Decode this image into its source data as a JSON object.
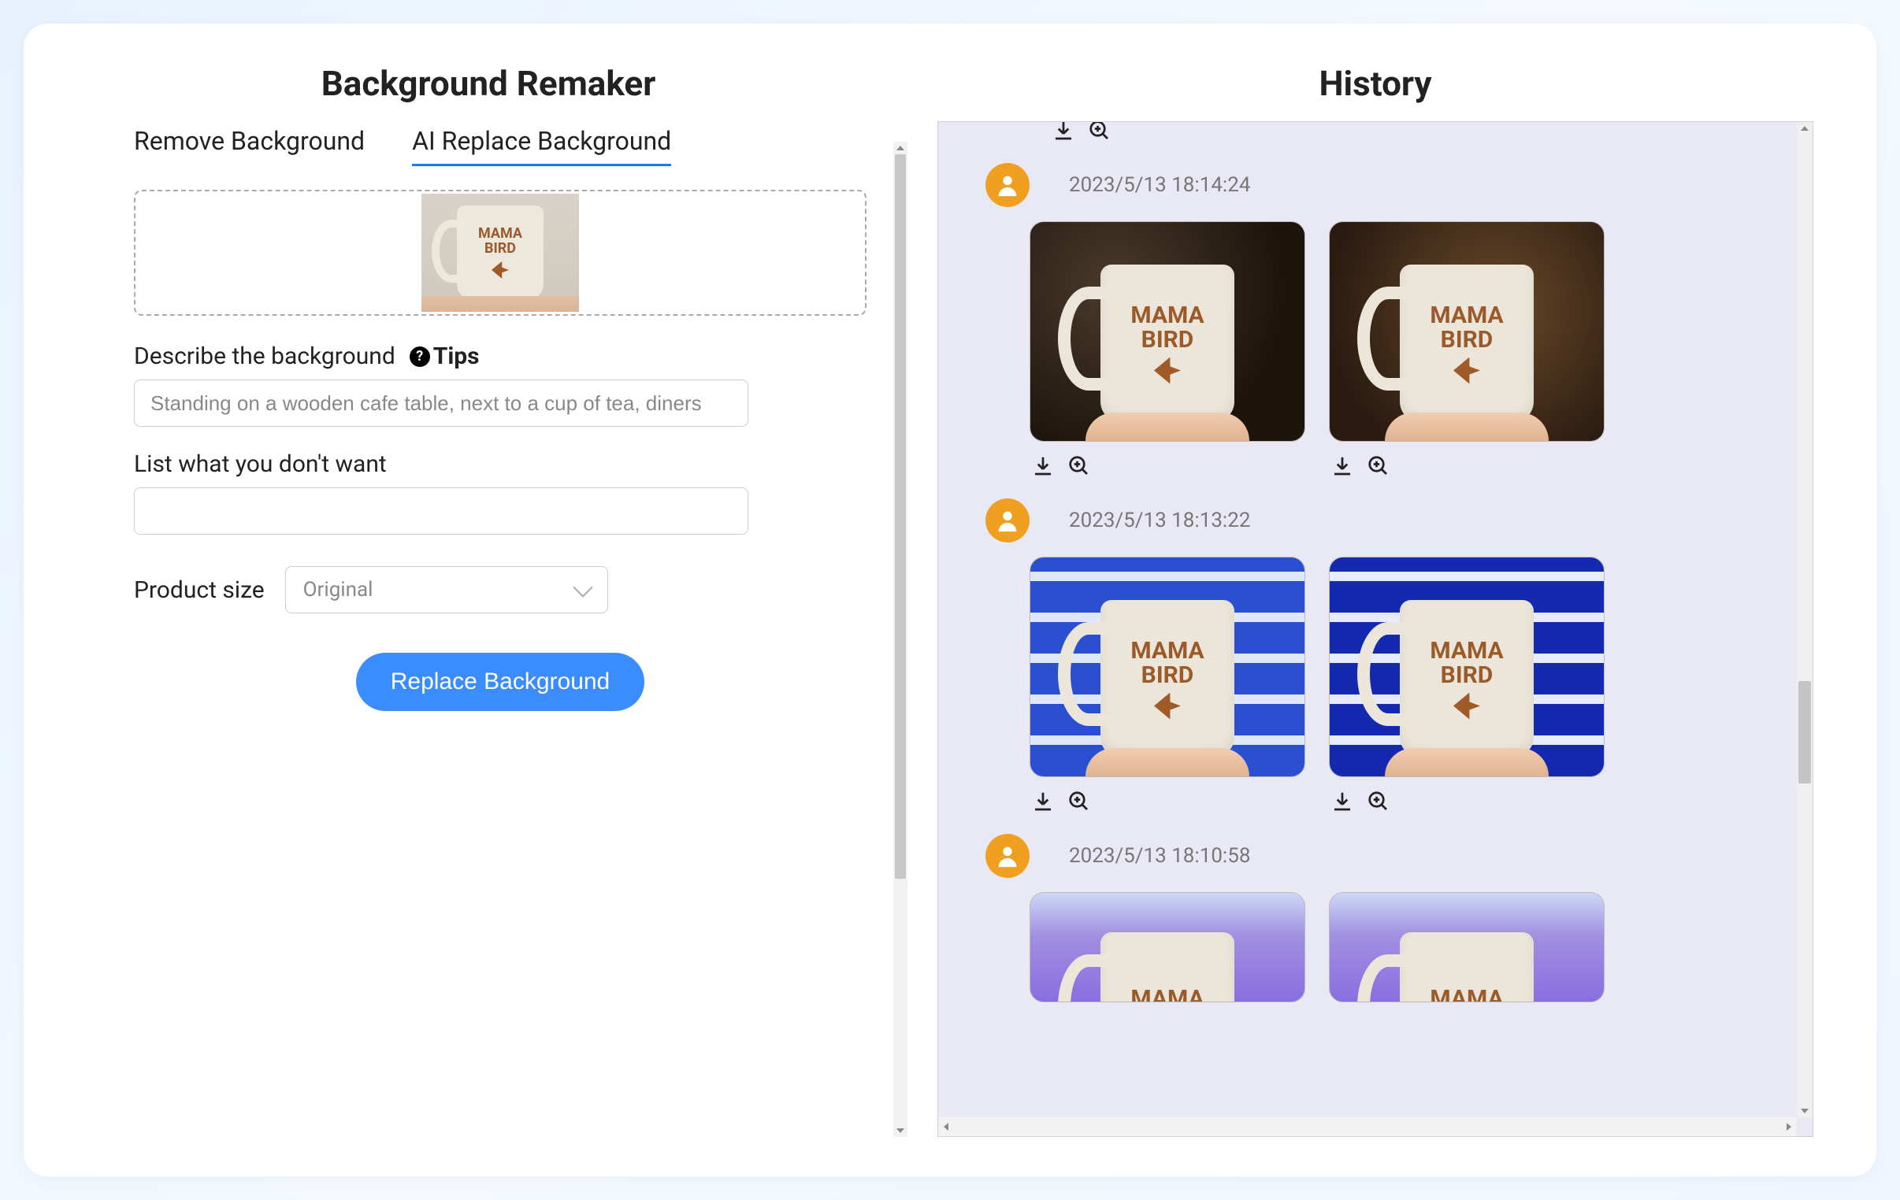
{
  "left": {
    "title": "Background Remaker",
    "tabs": {
      "remove": "Remove Background",
      "replace": "AI Replace Background"
    },
    "mug_text_line1": "MAMA",
    "mug_text_line2": "BIRD",
    "describe_label": "Describe the background",
    "tips_label": "Tips",
    "describe_placeholder": "Standing on a wooden cafe table, next to a cup of tea, diners",
    "exclude_label": "List what you don't want",
    "size_label": "Product size",
    "size_value": "Original",
    "submit_label": "Replace Background"
  },
  "right": {
    "title": "History",
    "items": [
      {
        "timestamp": "2023/5/13 18:14:24"
      },
      {
        "timestamp": "2023/5/13 18:13:22"
      },
      {
        "timestamp": "2023/5/13 18:10:58"
      }
    ]
  }
}
